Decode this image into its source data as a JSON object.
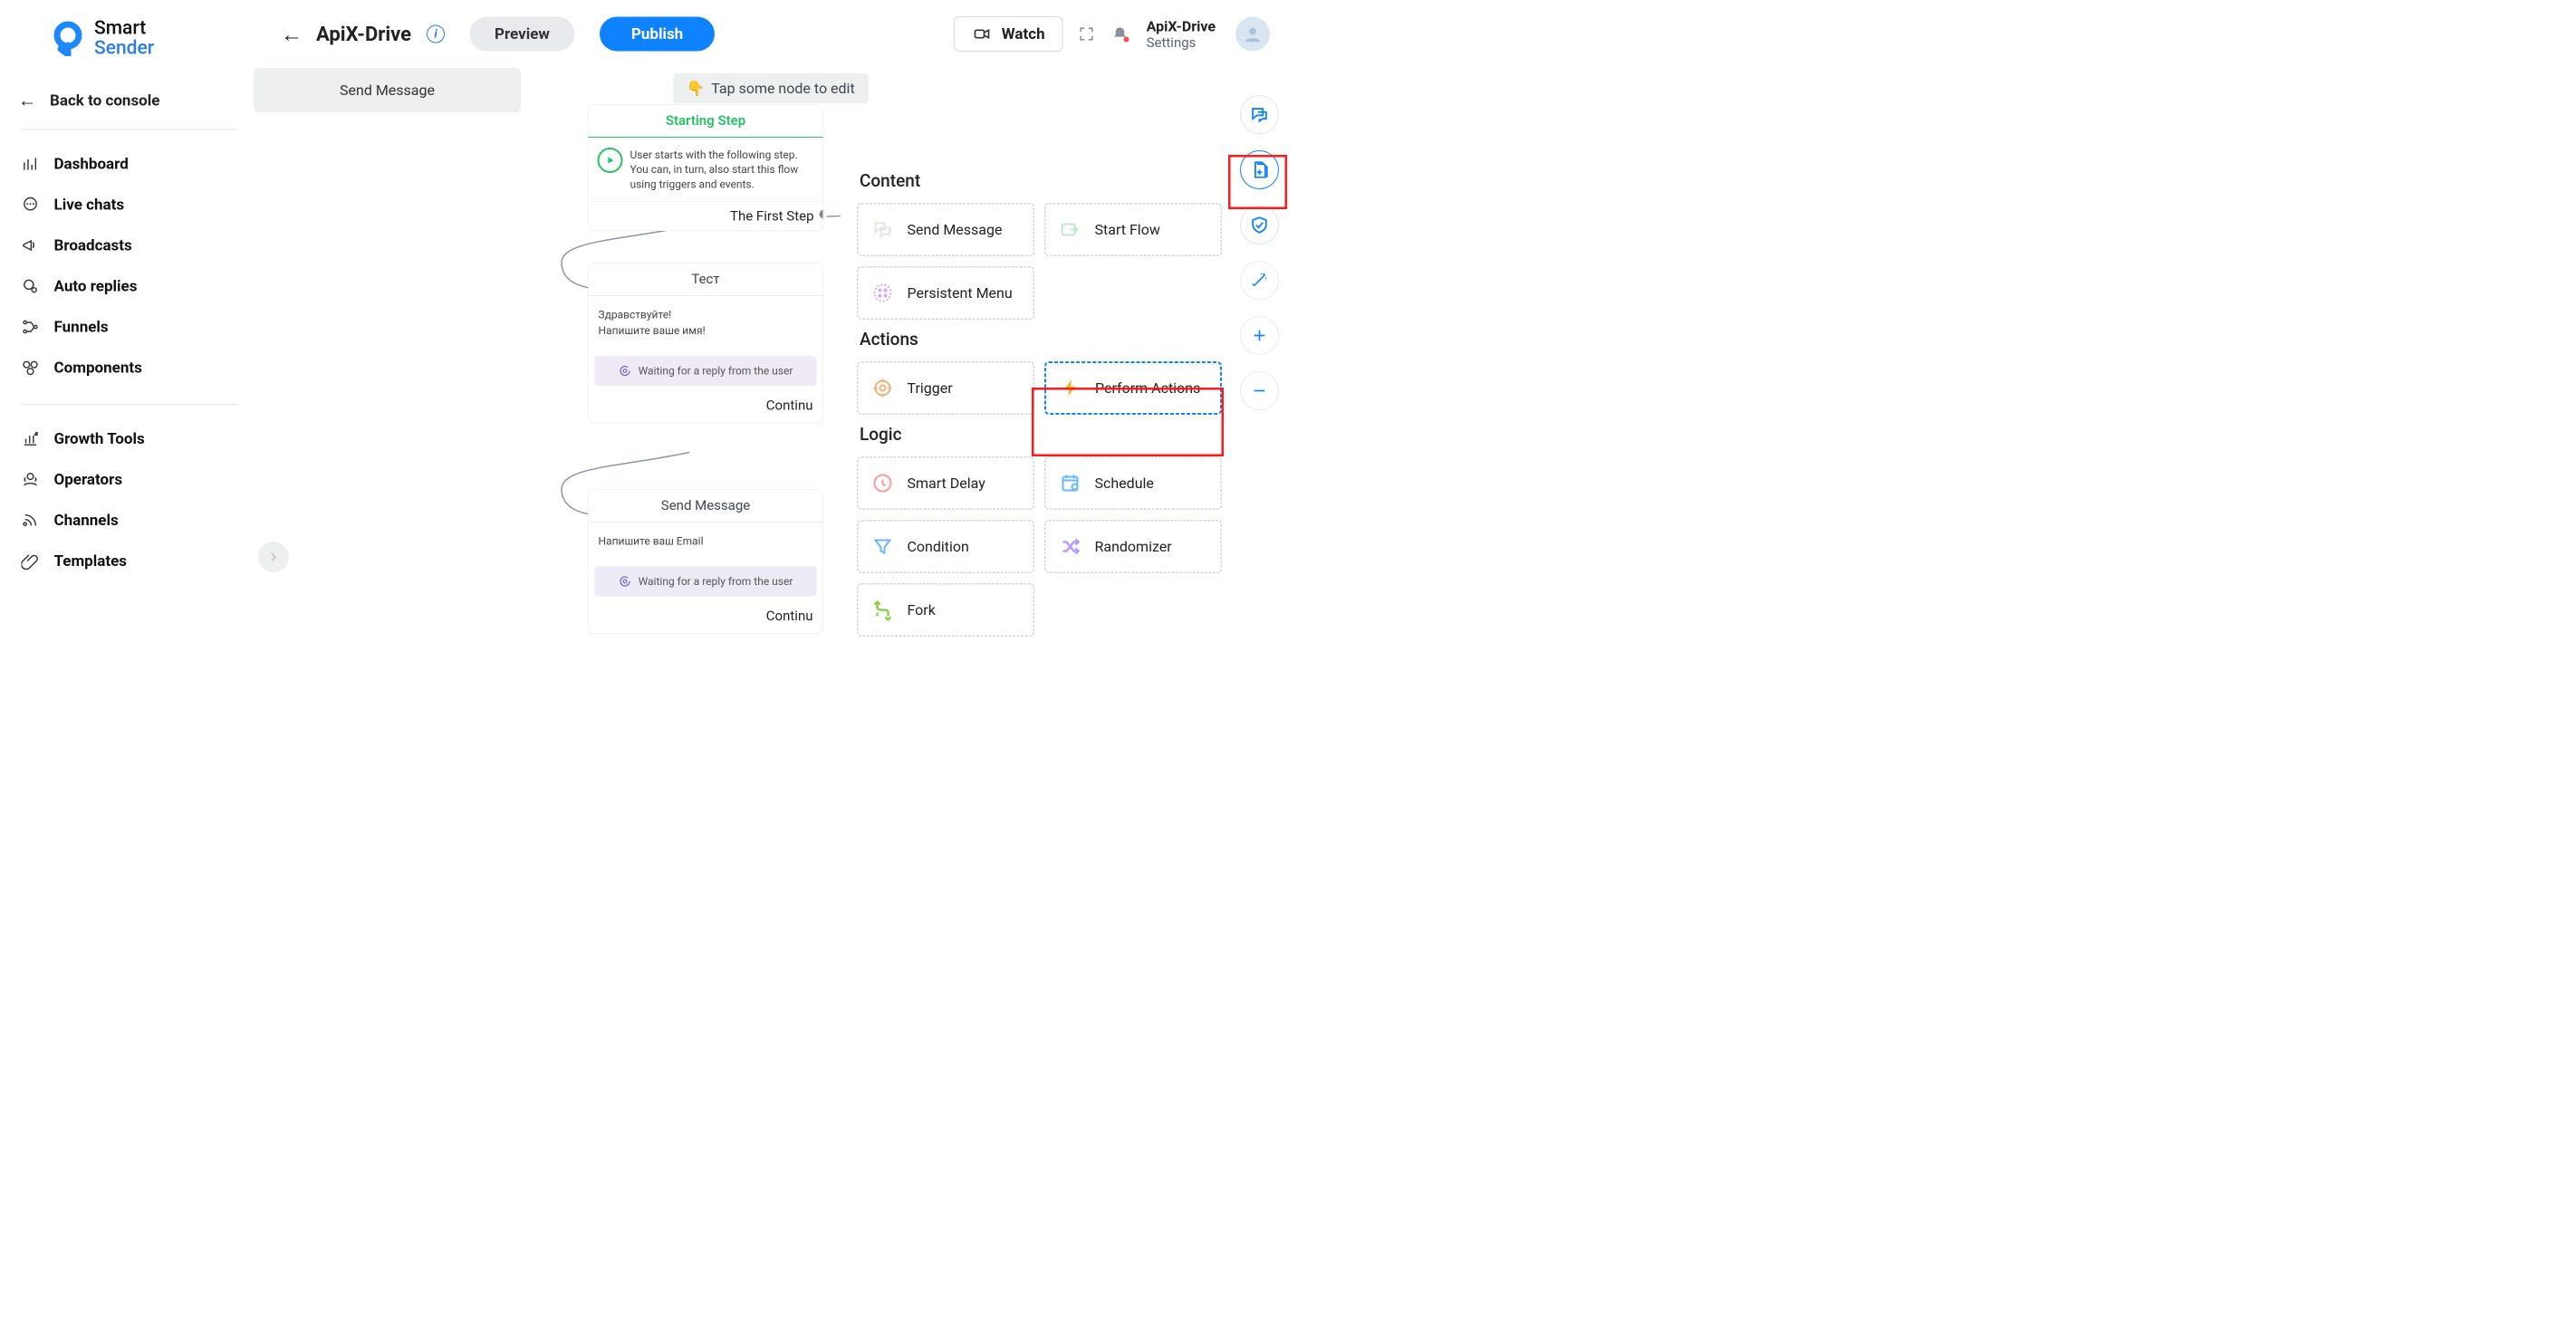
{
  "logo": {
    "t1": "Smart",
    "t2": "Sender"
  },
  "sidebar": {
    "back": "Back to console",
    "items": [
      "Dashboard",
      "Live chats",
      "Broadcasts",
      "Auto replies",
      "Funnels",
      "Components"
    ],
    "items2": [
      "Growth Tools",
      "Operators",
      "Channels",
      "Templates"
    ]
  },
  "topbar": {
    "title": "ApiX-Drive",
    "preview": "Preview",
    "publish": "Publish",
    "watch": "Watch",
    "user": "ApiX-Drive",
    "settings": "Settings"
  },
  "hint": "Tap some node to edit",
  "startNode": {
    "head": "Starting Step",
    "body": "User starts with the following step. You can, in turn, also start this flow using triggers and events.",
    "foot": "The First Step"
  },
  "testNode": {
    "head": "Тест",
    "m1": "Здравствуйте!",
    "m2": "Напишите ваше имя!",
    "wait": "Waiting for a reply from the user",
    "foot": "Continu"
  },
  "sendNode": {
    "head": "Send Message",
    "m1": "Напишите ваш Email",
    "wait": "Waiting for a reply from the user",
    "foot": "Continu"
  },
  "farNode": "Send Message",
  "panel": {
    "content": "Content",
    "actions": "Actions",
    "logic": "Logic",
    "tiles": {
      "send_message": "Send Message",
      "start_flow": "Start Flow",
      "persistent_menu": "Persistent Menu",
      "trigger": "Trigger",
      "perform_actions": "Perform Actions",
      "smart_delay": "Smart Delay",
      "schedule": "Schedule",
      "condition": "Condition",
      "randomizer": "Randomizer",
      "fork": "Fork"
    }
  }
}
